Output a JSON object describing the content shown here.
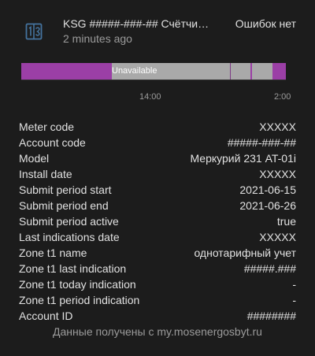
{
  "header": {
    "icon": "counter-meter-icon",
    "title": "KSG #####-###-## Счётчи…",
    "subtitle": "2 minutes ago",
    "state": "Ошибок нет"
  },
  "timeline": {
    "label": "Unavailable",
    "colors": {
      "primary": "#9b3fa6",
      "unavailable": "#a9a9a9"
    },
    "ticks": [
      "14:00",
      "2:00"
    ]
  },
  "attributes": [
    {
      "key": "Meter code",
      "value": "XXXXX"
    },
    {
      "key": "Account code",
      "value": "#####-###-##"
    },
    {
      "key": "Model",
      "value": "Меркурий 231 AT-01i"
    },
    {
      "key": "Install date",
      "value": "XXXXX"
    },
    {
      "key": "Submit period start",
      "value": "2021-06-15"
    },
    {
      "key": "Submit period end",
      "value": "2021-06-26"
    },
    {
      "key": "Submit period active",
      "value": "true"
    },
    {
      "key": "Last indications date",
      "value": "XXXXX"
    },
    {
      "key": "Zone t1 name",
      "value": "однотарифный учет"
    },
    {
      "key": "Zone t1 last indication",
      "value": "#####.###"
    },
    {
      "key": "Zone t1 today indication",
      "value": "-"
    },
    {
      "key": "Zone t1 period indication",
      "value": "-"
    },
    {
      "key": "Account ID",
      "value": "########"
    }
  ],
  "footer": "Данные получены с my.mosenergosbyt.ru"
}
